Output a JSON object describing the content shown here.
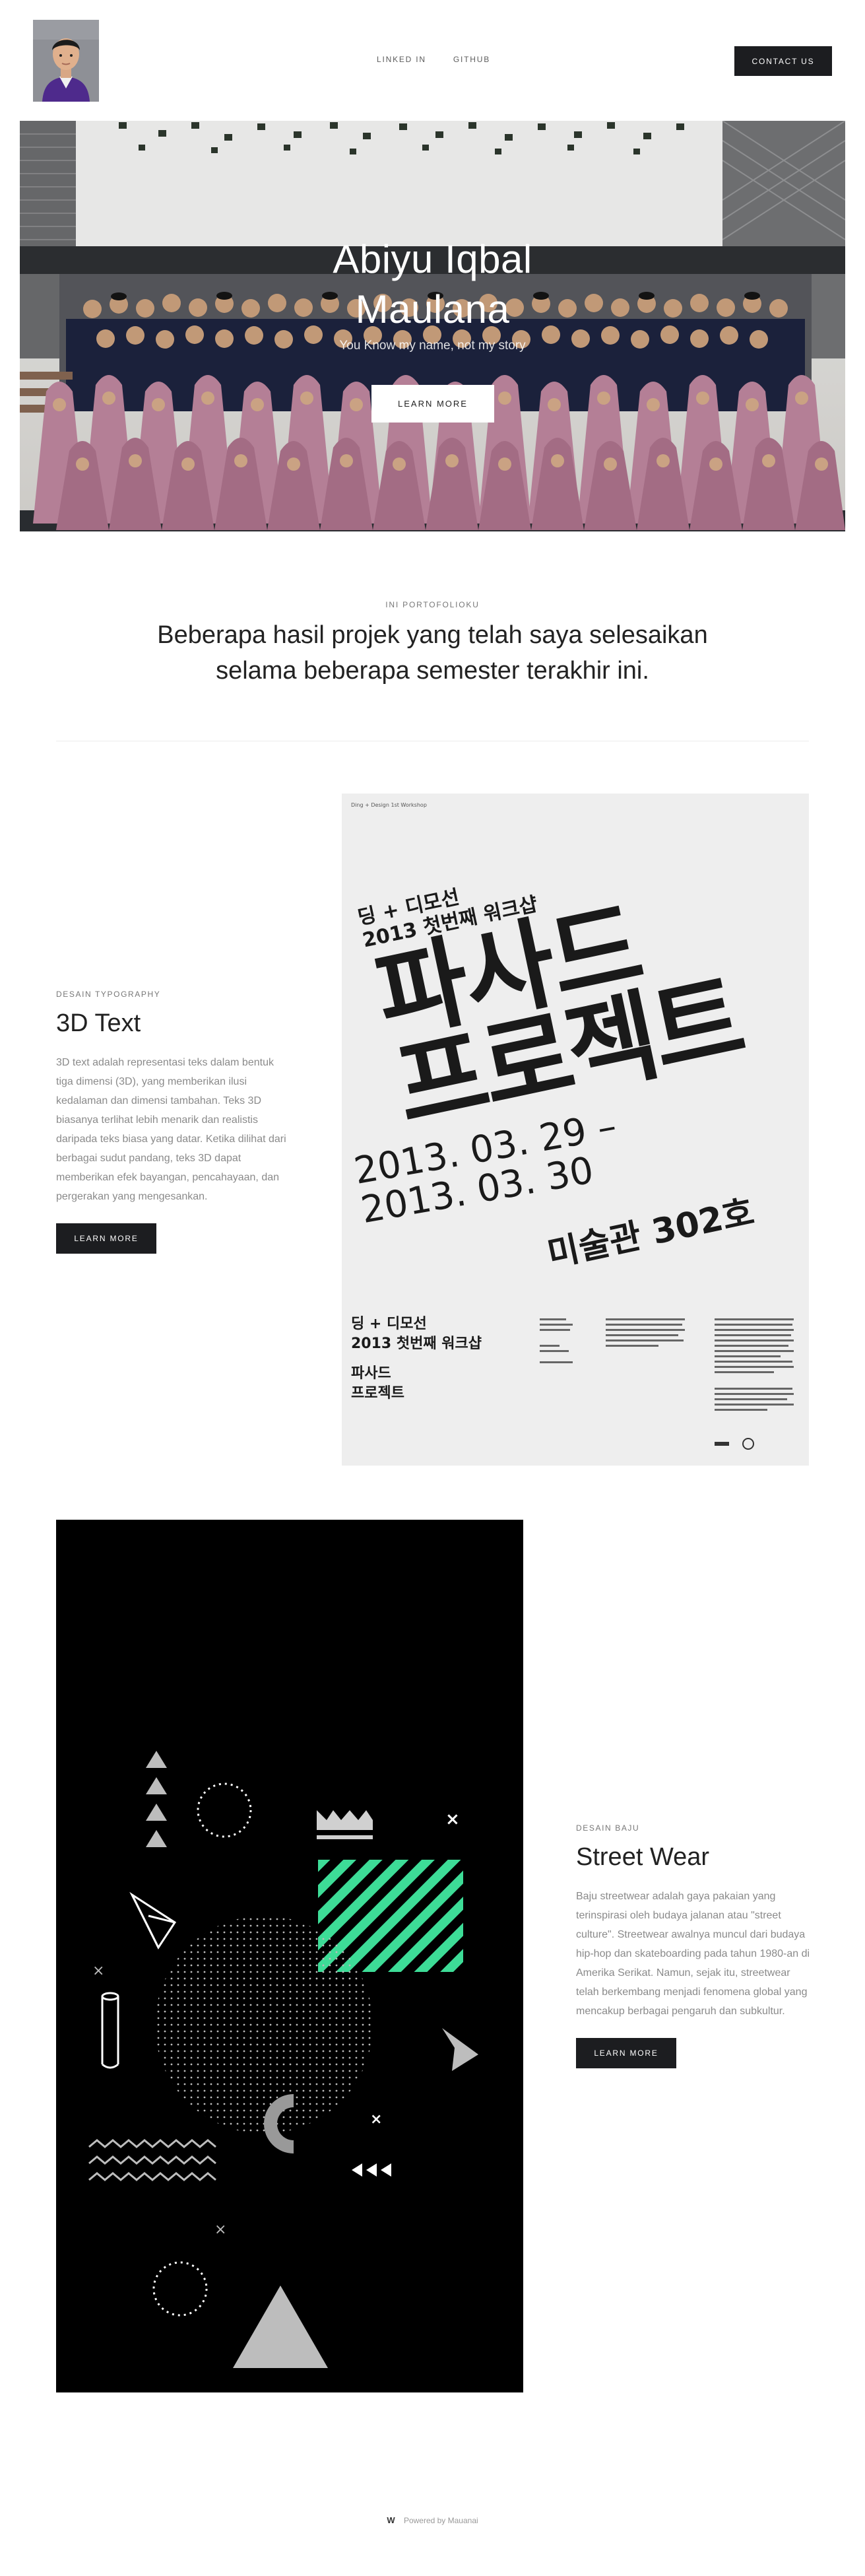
{
  "header": {
    "nav": [
      "LINKED IN",
      "GITHUB"
    ],
    "contact_label": "CONTACT US"
  },
  "hero": {
    "title_line1": "Abiyu Iqbal",
    "title_line2": "Maulana",
    "subtitle": "You Know my name, not my story",
    "button_label": "LEARN MORE"
  },
  "intro": {
    "eyebrow": "INI PORTOFOLIOKU",
    "heading": "Beberapa hasil projek yang telah saya selesaikan selama beberapa semester terakhir ini."
  },
  "projects": [
    {
      "eyebrow": "DESAIN TYPOGRAPHY",
      "title": "3D Text",
      "description": "3D text adalah representasi teks dalam bentuk tiga dimensi (3D), yang memberikan ilusi kedalaman dan dimensi tambahan. Teks 3D biasanya terlihat lebih menarik dan realistis daripada teks biasa yang datar. Ketika dilihat dari berbagai sudut pandang, teks 3D dapat memberikan efek bayangan, pencahayaan, dan pergerakan yang mengesankan.",
      "button_label": "LEARN MORE",
      "poster": {
        "top_small": "Ding + Design 1st Workshop",
        "header1": "딩 + 디모선",
        "header2": "2013 첫번째 워크샵",
        "big1": "파사드",
        "big2": "프로젝트",
        "date1": "2013. 03. 29 –",
        "date2": "2013. 03. 30",
        "venue": "미술관 302호",
        "foot1": "딩 + 디모선",
        "foot2": "2013 첫번째 워크샵",
        "foot3": "파사드",
        "foot4": "프로젝트"
      }
    },
    {
      "eyebrow": "DESAIN BAJU",
      "title": "Street Wear",
      "description": "Baju streetwear adalah gaya pakaian yang terinspirasi oleh budaya jalanan atau \"street culture\". Streetwear awalnya muncul dari budaya hip-hop dan skateboarding pada tahun 1980-an di Amerika Serikat. Namun, sejak itu, streetwear telah berkembang menjadi fenomena global yang mencakup berbagai pengaruh dan subkultur.",
      "button_label": "LEARN MORE"
    }
  ],
  "footer": {
    "logo": "W",
    "text": "Powered by Mauanai"
  },
  "colors": {
    "button_dark": "#1c1d20",
    "accent_green": "#3ddc97",
    "hijab_pink": "#c48aa3",
    "uniform_navy": "#1e2440"
  }
}
